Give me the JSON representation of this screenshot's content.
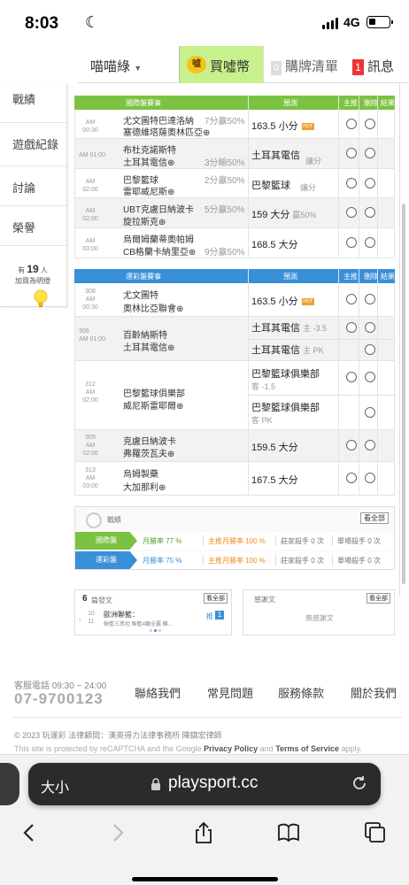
{
  "status": {
    "time": "8:03",
    "network": "4G"
  },
  "topbar": {
    "username": "喵喵綠",
    "buy_label": "買噓幣",
    "coin_glyph": "噓",
    "cart_count": "0",
    "cart_label": "購牌清單",
    "msg_count": "1",
    "msg_label": "訊息"
  },
  "sidebar": {
    "items": [
      "戰績",
      "遊戲紀錄",
      "討論",
      "榮譽"
    ],
    "join_prefix": "有",
    "join_count": "19",
    "join_unit": "人",
    "join_suffix": "加買為明燈"
  },
  "intl": {
    "header": {
      "match": "國際盤賽事",
      "predict": "預測",
      "home": "主推",
      "del": "刪除",
      "result": "結果"
    },
    "rows": [
      {
        "am": "AM",
        "time": "00:30",
        "teams": [
          "尤文圖特巴達洛納",
          "塞德維塔薩奧林匹亞⊕"
        ],
        "odds": [
          "7分贏50%",
          ""
        ],
        "pick": "163.5 小分",
        "sub": "",
        "hot": true
      },
      {
        "am": "AM 01:00",
        "time": "",
        "teams": [
          "布杜克諾斯特",
          "土耳其電信⊕"
        ],
        "odds": [
          "",
          "3分輸50%"
        ],
        "pick": "土耳其電信",
        "sub": "讓分",
        "hot": false
      },
      {
        "am": "AM",
        "time": "02:00",
        "teams": [
          "巴黎籃球",
          "雷耶威尼斯⊕"
        ],
        "odds": [
          "2分贏50%",
          ""
        ],
        "pick": "巴黎籃球",
        "sub": "讓分",
        "hot": false
      },
      {
        "am": "AM",
        "time": "02:00",
        "teams": [
          "UBT克盧日納波卡",
          "旋拉斯克⊕"
        ],
        "odds": [
          "5分贏50%",
          ""
        ],
        "pick": "159 大分",
        "sub": "贏50%",
        "hot": false
      },
      {
        "am": "AM",
        "time": "03:00",
        "teams": [
          "烏爾姆蘭蒂奧帕姆",
          "CB格蘭卡納里亞⊕"
        ],
        "odds": [
          "",
          "9分贏50%"
        ],
        "pick": "168.5 大分",
        "sub": "",
        "hot": false
      }
    ]
  },
  "lottery": {
    "header": {
      "match": "運彩盤賽事",
      "predict": "預測",
      "home": "主推",
      "del": "刪除",
      "result": "結果"
    },
    "rows": [
      {
        "num": "308",
        "am": "AM",
        "time": "00:30",
        "teams": [
          "尤文圖特",
          "奧林比亞聯會⊕"
        ],
        "picks": [
          {
            "pick": "163.5 小分",
            "sub": "",
            "hot": true
          }
        ]
      },
      {
        "num": "306",
        "am": "AM 01:00",
        "time": "",
        "teams": [
          "百齡納斯特",
          "土耳其電信⊕"
        ],
        "picks": [
          {
            "pick": "土耳其電信",
            "sub": "主 -3.5",
            "hot": false
          },
          {
            "pick": "土耳其電信",
            "sub": "主 PK",
            "hot": false
          }
        ]
      },
      {
        "num": "312",
        "am": "AM",
        "time": "02:00",
        "teams": [
          "巴黎籃球俱樂部",
          "威尼斯雷耶爾⊕"
        ],
        "picks": [
          {
            "pick": "巴黎籃球俱樂部",
            "sub2": "客 -1.5",
            "hot": false
          },
          {
            "pick": "巴黎籃球俱樂部",
            "sub2": "客 PK",
            "hot": false
          }
        ]
      },
      {
        "num": "309",
        "am": "AM",
        "time": "02:00",
        "teams": [
          "克盧日納波卡",
          "弗羅茨瓦夫⊕"
        ],
        "picks": [
          {
            "pick": "159.5 大分",
            "sub": "",
            "hot": false
          }
        ]
      },
      {
        "num": "313",
        "am": "AM",
        "time": "03:00",
        "teams": [
          "烏姆製藥",
          "大加那利⊕"
        ],
        "picks": [
          {
            "pick": "167.5 大分",
            "sub": "",
            "hot": false
          }
        ]
      }
    ]
  },
  "stats": {
    "label": "戰績",
    "view_all": "看全部",
    "lines": [
      {
        "tag": "國際盤",
        "monthly": "月勝率 77 %",
        "home_monthly": "主推月勝率 100 %",
        "streak": "莊家殺手 0 次",
        "single": "單場殺手 0 次",
        "color": "#7cc242"
      },
      {
        "tag": "運彩盤",
        "monthly": "月勝率 75 %",
        "home_monthly": "主推月勝率 100 %",
        "streak": "莊家殺手 0 次",
        "single": "單場殺手 0 次",
        "color": "#3a8fd9"
      }
    ]
  },
  "posts": {
    "count": "6",
    "label": "篇發文",
    "view_all": "看全部",
    "date_top": "10",
    "date_bottom": "11",
    "title": "歐洲聯籃：",
    "preview": "聯籃三串坦 聯籃4顆全贏 轉...",
    "rank": "推",
    "rank_num": "1"
  },
  "news": {
    "label": "感謝文",
    "view_all": "看全部",
    "empty": "無感謝文"
  },
  "footer": {
    "hotline_label": "客服電話 09:30 ~ 24:00",
    "hotline": "07-9700123",
    "links": [
      "聯絡我們",
      "常見問題",
      "服務條款",
      "關於我們"
    ],
    "copyright": "© 2023 玩運彩 法律顧問：漢英得力法律事務所 陳鎮宏律師",
    "captcha_pre": "This site is protected by reCAPTCHA and the Google ",
    "privacy": "Privacy Policy",
    "and": " and ",
    "terms": "Terms of Service",
    "apply": " apply."
  },
  "browser": {
    "text_size": "大小",
    "domain": "playsport.cc"
  }
}
